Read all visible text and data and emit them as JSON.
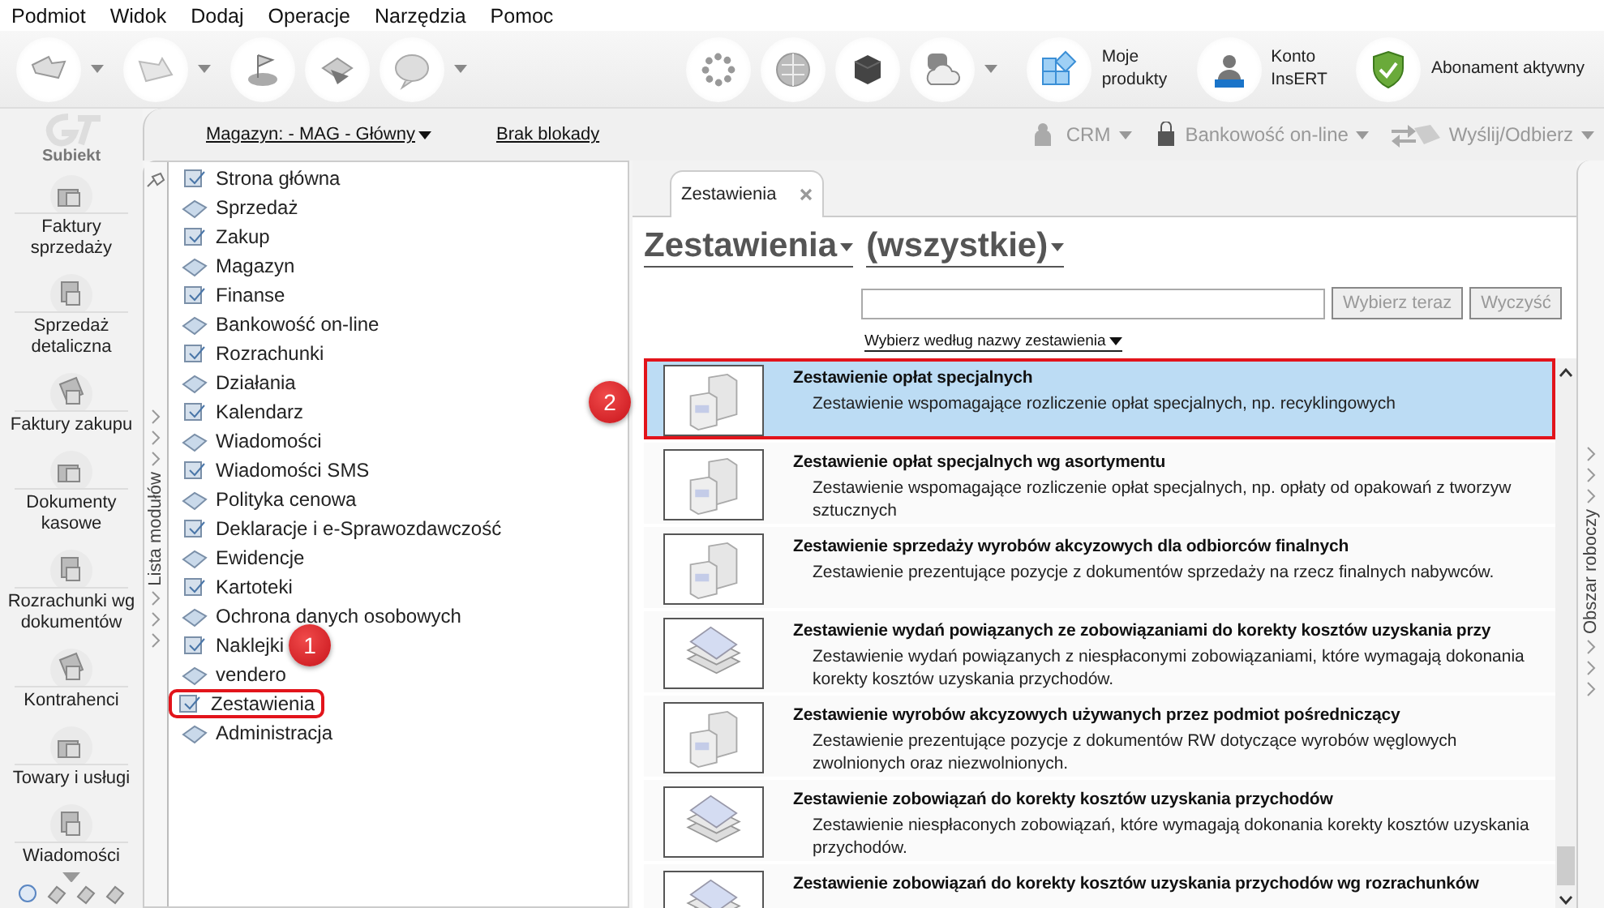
{
  "menu_bar": [
    "Podmiot",
    "Widok",
    "Dodaj",
    "Operacje",
    "Narzędzia",
    "Pomoc"
  ],
  "toolbar": {
    "labeled_buttons": [
      {
        "kind": "products",
        "lines": [
          "Moje",
          "produkty"
        ]
      },
      {
        "kind": "account",
        "lines": [
          "Konto",
          "InsERT"
        ]
      },
      {
        "kind": "subscription",
        "lines": [
          "Abonament aktywny"
        ]
      }
    ]
  },
  "secondary_bar": {
    "warehouse": "Magazyn: - MAG - Główny",
    "lock": "Brak blokady",
    "actions": [
      "CRM",
      "Bankowość on-line",
      "Wyślij/Odbierz"
    ]
  },
  "nav": {
    "logo": "Subiekt",
    "items": [
      {
        "label": "Faktury sprzedaży"
      },
      {
        "label": "Sprzedaż detaliczna"
      },
      {
        "label": "Faktury zakupu"
      },
      {
        "label": "Dokumenty kasowe"
      },
      {
        "label": "Rozrachunki wg dokumentów"
      },
      {
        "label": "Kontrahenci"
      },
      {
        "label": "Towary i usługi"
      },
      {
        "label": "Wiadomości"
      }
    ]
  },
  "modules": {
    "title": "Lista modułów",
    "items": [
      {
        "label": "Strona główna",
        "annotated": false
      },
      {
        "label": "Sprzedaż",
        "annotated": false
      },
      {
        "label": "Zakup",
        "annotated": false
      },
      {
        "label": "Magazyn",
        "annotated": false
      },
      {
        "label": "Finanse",
        "annotated": false
      },
      {
        "label": "Bankowość on-line",
        "annotated": false
      },
      {
        "label": "Rozrachunki",
        "annotated": false
      },
      {
        "label": "Działania",
        "annotated": false
      },
      {
        "label": "Kalendarz",
        "annotated": false
      },
      {
        "label": "Wiadomości",
        "annotated": false
      },
      {
        "label": "Wiadomości SMS",
        "annotated": false
      },
      {
        "label": "Polityka cenowa",
        "annotated": false
      },
      {
        "label": "Deklaracje i e-Sprawozdawczość",
        "annotated": false
      },
      {
        "label": "Ewidencje",
        "annotated": false
      },
      {
        "label": "Kartoteki",
        "annotated": false
      },
      {
        "label": "Ochrona danych osobowych",
        "annotated": false
      },
      {
        "label": "Naklejki",
        "annotated": false
      },
      {
        "label": "vendero",
        "annotated": false
      },
      {
        "label": "Zestawienia",
        "annotated": true
      },
      {
        "label": "Administracja",
        "annotated": false
      }
    ]
  },
  "tabs": [
    {
      "label": "Zestawienia",
      "selected": true
    }
  ],
  "heading": {
    "category": "Zestawienia",
    "filter": "(wszystkie)"
  },
  "search": {
    "buttons": [
      "Wybierz teraz",
      "Wyczyść"
    ],
    "mode": "Wybierz według nazwy zestawienia"
  },
  "reports": [
    {
      "kind": "boxes",
      "title": "Zestawienie opłat specjalnych",
      "description": "Zestawienie wspomagające rozliczenie opłat specjalnych, np. recyklingowych",
      "selected": true,
      "annotated": true
    },
    {
      "kind": "boxes",
      "title": "Zestawienie opłat specjalnych wg asortymentu",
      "description": "Zestawienie wspomagające rozliczenie opłat specjalnych, np. opłaty od opakowań z tworzyw sztucznych",
      "selected": false,
      "annotated": false
    },
    {
      "kind": "boxes",
      "title": "Zestawienie sprzedaży wyrobów akcyzowych dla odbiorców finalnych",
      "description": "Zestawienie prezentujące pozycje z dokumentów sprzedaży na rzecz finalnych nabywców.",
      "selected": false,
      "annotated": false
    },
    {
      "kind": "sheets",
      "title": "Zestawienie wydań powiązanych ze zobowiązaniami do korekty kosztów uzyskania przy",
      "description": "Zestawienie wydań powiązanych z niespłaconymi zobowiązaniami, które wymagają dokonania korekty kosztów uzyskania przychodów.",
      "selected": false,
      "annotated": false
    },
    {
      "kind": "boxes",
      "title": "Zestawienie wyrobów akcyzowych używanych przez podmiot pośredniczący",
      "description": "Zestawienie prezentujące pozycje z dokumentów RW dotyczące wyrobów węglowych zwolnionych oraz niezwolnionych.",
      "selected": false,
      "annotated": false
    },
    {
      "kind": "sheets",
      "title": "Zestawienie zobowiązań do korekty kosztów uzyskania przychodów",
      "description": "Zestawienie niespłaconych zobowiązań, które wymagają dokonania korekty kosztów uzyskania przychodów.",
      "selected": false,
      "annotated": false
    },
    {
      "kind": "sheets",
      "title": "Zestawienie zobowiązań do korekty kosztów uzyskania przychodów wg rozrachunków",
      "selected": false,
      "annotated": false
    }
  ],
  "side_panel": {
    "title": "Obszar roboczy"
  },
  "annotations": [
    {
      "label": "1"
    },
    {
      "label": "2"
    }
  ]
}
